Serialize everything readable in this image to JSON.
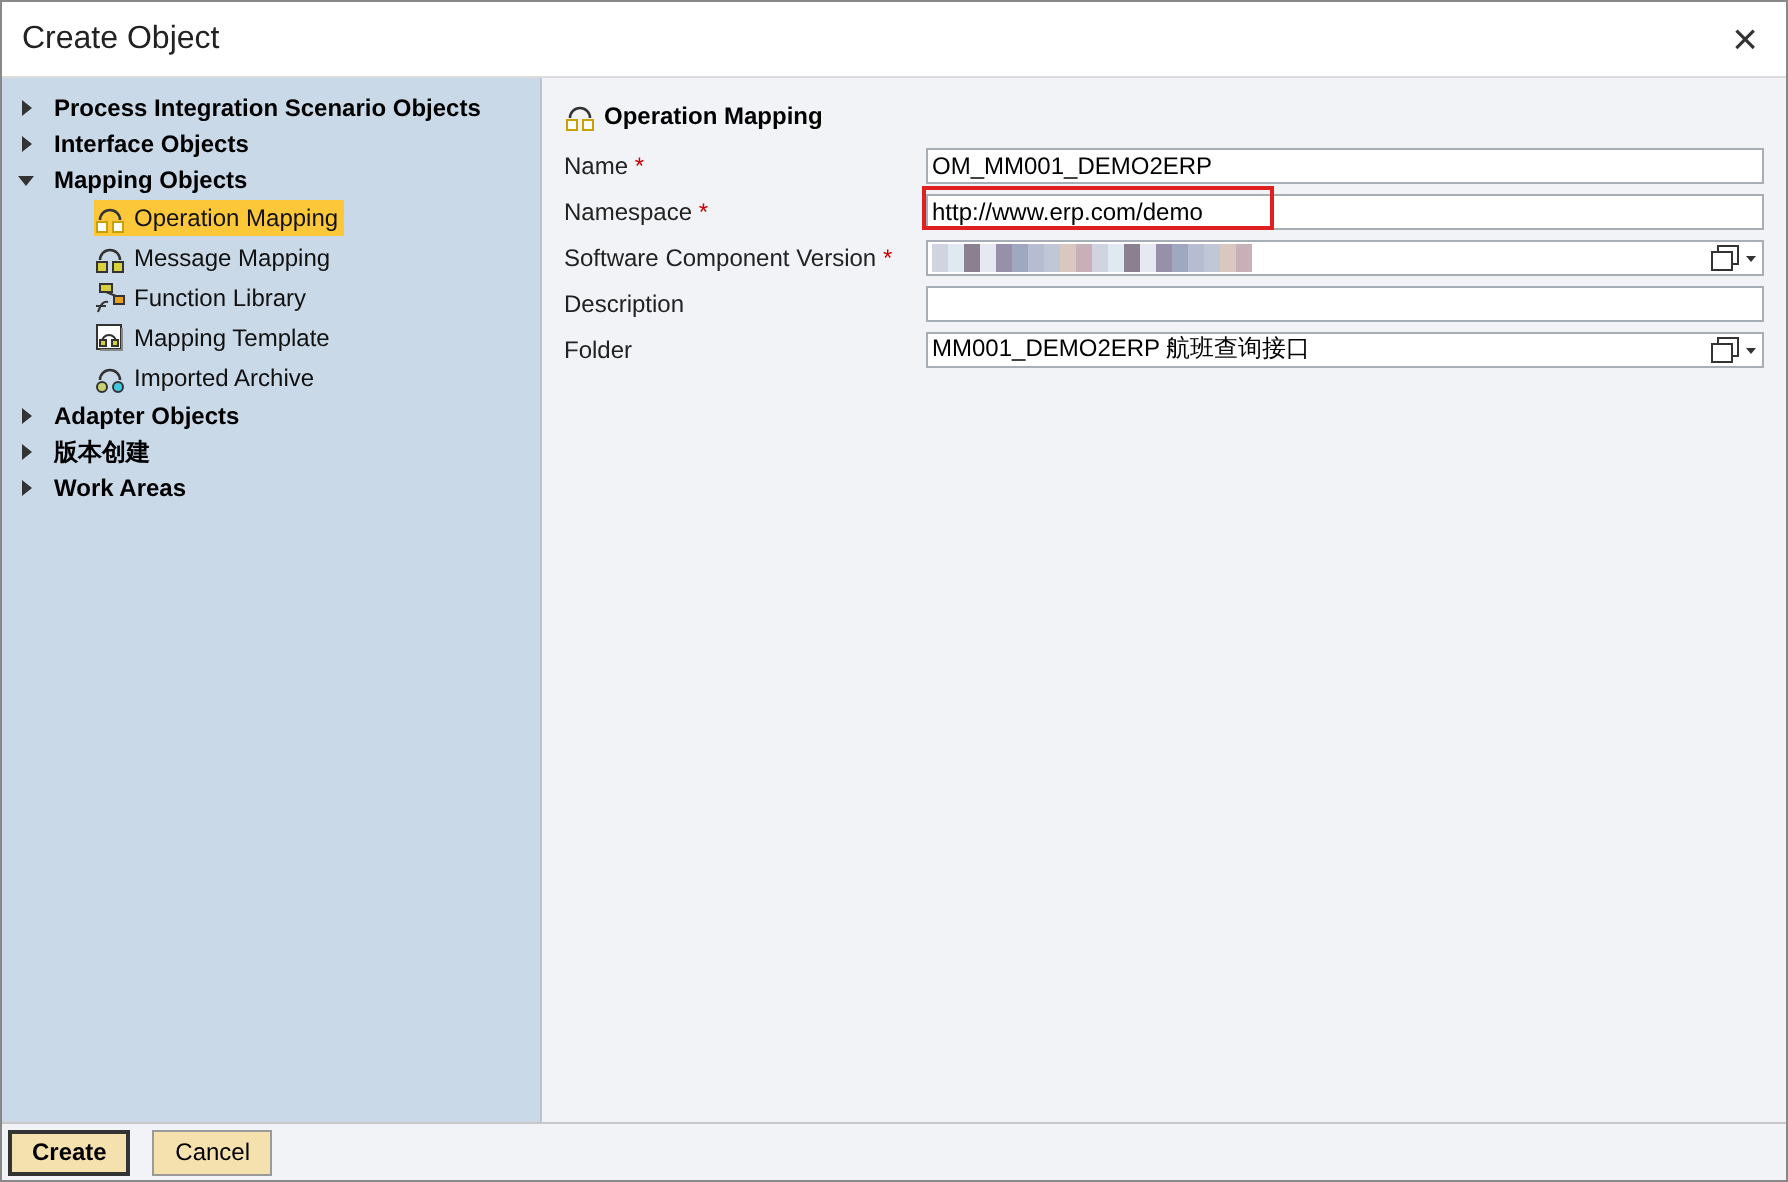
{
  "window": {
    "title": "Create Object",
    "close": "×"
  },
  "tree": [
    {
      "label": "Process Integration Scenario Objects",
      "expanded": false
    },
    {
      "label": "Interface Objects",
      "expanded": false
    },
    {
      "label": "Mapping Objects",
      "expanded": true,
      "children": [
        {
          "label": "Operation Mapping",
          "selected": true,
          "kind": "operation"
        },
        {
          "label": "Message Mapping",
          "selected": false,
          "kind": "message"
        },
        {
          "label": "Function Library",
          "selected": false,
          "kind": "function"
        },
        {
          "label": "Mapping Template",
          "selected": false,
          "kind": "template"
        },
        {
          "label": "Imported Archive",
          "selected": false,
          "kind": "archive"
        }
      ]
    },
    {
      "label": "Adapter Objects",
      "expanded": false
    },
    {
      "label": "版本创建",
      "expanded": false
    },
    {
      "label": "Work Areas",
      "expanded": false
    }
  ],
  "form": {
    "title": "Operation Mapping",
    "fields": [
      {
        "label": "Name",
        "required_mark": "*",
        "value": "OM_MM001_DEMO2ERP",
        "kind": "text"
      },
      {
        "label": "Namespace",
        "required_mark": "*",
        "value": "http://www.erp.com/demo",
        "kind": "text",
        "highlighted": true
      },
      {
        "label": "Software Component Version",
        "required_mark": "*",
        "kind": "blurred",
        "dropdown": true
      },
      {
        "label": "Description",
        "kind": "text"
      },
      {
        "label": "Folder",
        "value": "MM001_DEMO2ERP 航班查询接口",
        "kind": "text",
        "dropdown": true
      }
    ]
  },
  "buttons": [
    {
      "label": "Create",
      "default": true
    },
    {
      "label": "Cancel",
      "default": false
    }
  ]
}
